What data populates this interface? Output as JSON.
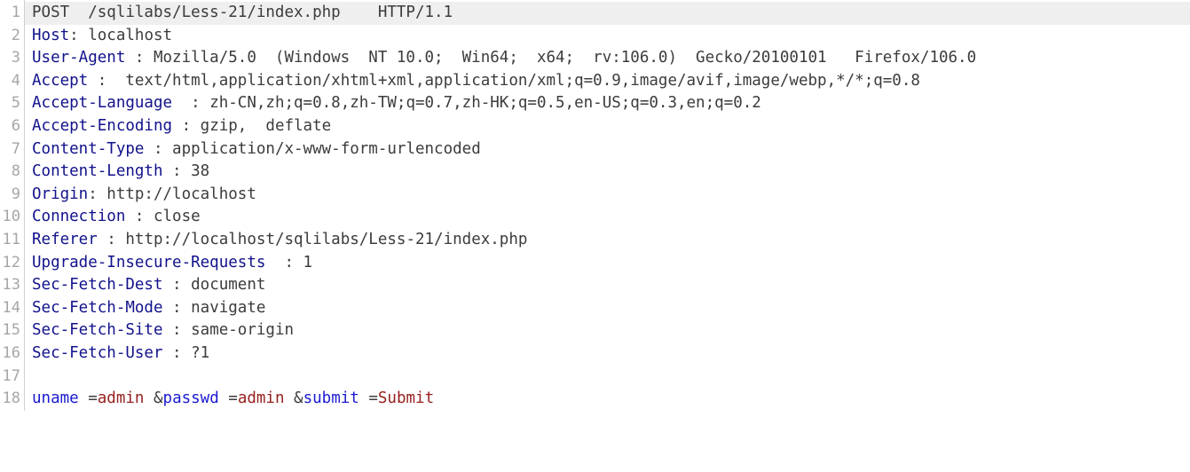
{
  "viewer": {
    "kind": "http-raw-request-viewer",
    "total_lines": 18,
    "highlighted_line": 1,
    "colors": {
      "background": "#ffffff",
      "highlight_row": "#efefef",
      "gutter_text": "#a6a6a6",
      "gutter_divider": "#d0d0d0",
      "header_name": "#12128c",
      "header_value": "#3c3c3c",
      "body_param_name": "#1a1ad0",
      "body_param_value": "#96201f",
      "body_separator": "#3c3c3c"
    }
  },
  "gutter": {
    "numbers": [
      "1",
      "2",
      "3",
      "4",
      "5",
      "6",
      "7",
      "8",
      "9",
      "10",
      "11",
      "12",
      "13",
      "14",
      "15",
      "16",
      "17",
      "18"
    ]
  },
  "lines": [
    {
      "n": "1",
      "highlight": true,
      "tokens": [
        {
          "t": "POST  /sqlilabs/Less-21/index.php    HTTP/1.1",
          "c": "tok-plain"
        }
      ]
    },
    {
      "n": "2",
      "highlight": false,
      "tokens": [
        {
          "t": "Host",
          "c": "tok-key"
        },
        {
          "t": ": localhost",
          "c": "tok-val"
        }
      ]
    },
    {
      "n": "3",
      "highlight": false,
      "tokens": [
        {
          "t": "User-Agent",
          "c": "tok-key"
        },
        {
          "t": " : Mozilla/5.0  (Windows  NT 10.0;  Win64;  x64;  rv:106.0)  Gecko/20100101   Firefox/106.0",
          "c": "tok-val"
        }
      ]
    },
    {
      "n": "4",
      "highlight": false,
      "tokens": [
        {
          "t": "Accept",
          "c": "tok-key"
        },
        {
          "t": " :  text/html,application/xhtml+xml,application/xml;q=0.9,image/avif,image/webp,*/*;q=0.8",
          "c": "tok-val"
        }
      ]
    },
    {
      "n": "5",
      "highlight": false,
      "tokens": [
        {
          "t": "Accept-Language",
          "c": "tok-key"
        },
        {
          "t": "  : zh-CN,zh;q=0.8,zh-TW;q=0.7,zh-HK;q=0.5,en-US;q=0.3,en;q=0.2",
          "c": "tok-val"
        }
      ]
    },
    {
      "n": "6",
      "highlight": false,
      "tokens": [
        {
          "t": "Accept-Encoding",
          "c": "tok-key"
        },
        {
          "t": " : gzip,  deflate",
          "c": "tok-val"
        }
      ]
    },
    {
      "n": "7",
      "highlight": false,
      "tokens": [
        {
          "t": "Content-Type",
          "c": "tok-key"
        },
        {
          "t": " : application/x-www-form-urlencoded",
          "c": "tok-val"
        }
      ]
    },
    {
      "n": "8",
      "highlight": false,
      "tokens": [
        {
          "t": "Content-Length",
          "c": "tok-key"
        },
        {
          "t": " : 38",
          "c": "tok-val"
        }
      ]
    },
    {
      "n": "9",
      "highlight": false,
      "tokens": [
        {
          "t": "Origin",
          "c": "tok-key"
        },
        {
          "t": ": http://localhost",
          "c": "tok-val"
        }
      ]
    },
    {
      "n": "10",
      "highlight": false,
      "tokens": [
        {
          "t": "Connection",
          "c": "tok-key"
        },
        {
          "t": " : close",
          "c": "tok-val"
        }
      ]
    },
    {
      "n": "11",
      "highlight": false,
      "tokens": [
        {
          "t": "Referer",
          "c": "tok-key"
        },
        {
          "t": " : http://localhost/sqlilabs/Less-21/index.php",
          "c": "tok-val"
        }
      ]
    },
    {
      "n": "12",
      "highlight": false,
      "tokens": [
        {
          "t": "Upgrade-Insecure-Requests",
          "c": "tok-key"
        },
        {
          "t": "  : 1",
          "c": "tok-val"
        }
      ]
    },
    {
      "n": "13",
      "highlight": false,
      "tokens": [
        {
          "t": "Sec-Fetch-Dest",
          "c": "tok-key"
        },
        {
          "t": " : document",
          "c": "tok-val"
        }
      ]
    },
    {
      "n": "14",
      "highlight": false,
      "tokens": [
        {
          "t": "Sec-Fetch-Mode",
          "c": "tok-key"
        },
        {
          "t": " : navigate",
          "c": "tok-val"
        }
      ]
    },
    {
      "n": "15",
      "highlight": false,
      "tokens": [
        {
          "t": "Sec-Fetch-Site",
          "c": "tok-key"
        },
        {
          "t": " : same-origin",
          "c": "tok-val"
        }
      ]
    },
    {
      "n": "16",
      "highlight": false,
      "tokens": [
        {
          "t": "Sec-Fetch-User",
          "c": "tok-key"
        },
        {
          "t": " : ?1",
          "c": "tok-val"
        }
      ]
    },
    {
      "n": "17",
      "highlight": false,
      "tokens": []
    },
    {
      "n": "18",
      "highlight": false,
      "tokens": [
        {
          "t": "uname",
          "c": "tok-param"
        },
        {
          "t": " =",
          "c": "tok-sep"
        },
        {
          "t": "admin",
          "c": "tok-data"
        },
        {
          "t": " &",
          "c": "tok-sep"
        },
        {
          "t": "passwd",
          "c": "tok-param"
        },
        {
          "t": " =",
          "c": "tok-sep"
        },
        {
          "t": "admin",
          "c": "tok-data"
        },
        {
          "t": " &",
          "c": "tok-sep"
        },
        {
          "t": "submit",
          "c": "tok-param"
        },
        {
          "t": " =",
          "c": "tok-sep"
        },
        {
          "t": "Submit",
          "c": "tok-data"
        }
      ]
    }
  ],
  "request_summary": {
    "method": "POST",
    "path": "/sqlilabs/Less-21/index.php",
    "protocol": "HTTP/1.1",
    "body_params": [
      {
        "name": "uname",
        "value": "admin"
      },
      {
        "name": "passwd",
        "value": "admin"
      },
      {
        "name": "submit",
        "value": "Submit"
      }
    ]
  }
}
